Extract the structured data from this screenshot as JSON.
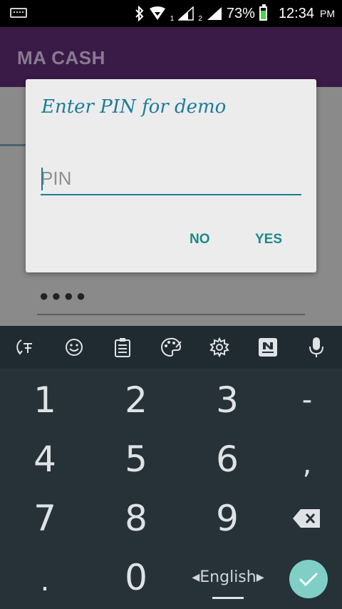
{
  "status_bar": {
    "battery_percent": "73%",
    "time": "12:34",
    "ampm": "PM",
    "sim1_label": "1",
    "sim2_label": "2"
  },
  "app": {
    "title": "MA CASH",
    "password_dots": "●●●●"
  },
  "dialog": {
    "title": "Enter PIN  for demo",
    "pin_placeholder": "PIN",
    "pin_value": "",
    "no_label": "NO",
    "yes_label": "YES"
  },
  "keyboard": {
    "toolbar_icons": [
      "translate-icon",
      "emoji-icon",
      "clipboard-icon",
      "theme-palette-icon",
      "settings-icon",
      "news-icon",
      "microphone-icon"
    ],
    "rows": [
      [
        "1",
        "2",
        "3",
        "-"
      ],
      [
        "4",
        "5",
        "6",
        ","
      ],
      [
        "7",
        "8",
        "9"
      ],
      [
        ".",
        "0"
      ]
    ],
    "language_label": "◂English▸",
    "enter_color": "#7fcfc6"
  },
  "colors": {
    "accent": "#1d7c9a",
    "button_text": "#1b8a89",
    "appbar": "#3a1a47",
    "keyboard_bg": "#263238"
  }
}
